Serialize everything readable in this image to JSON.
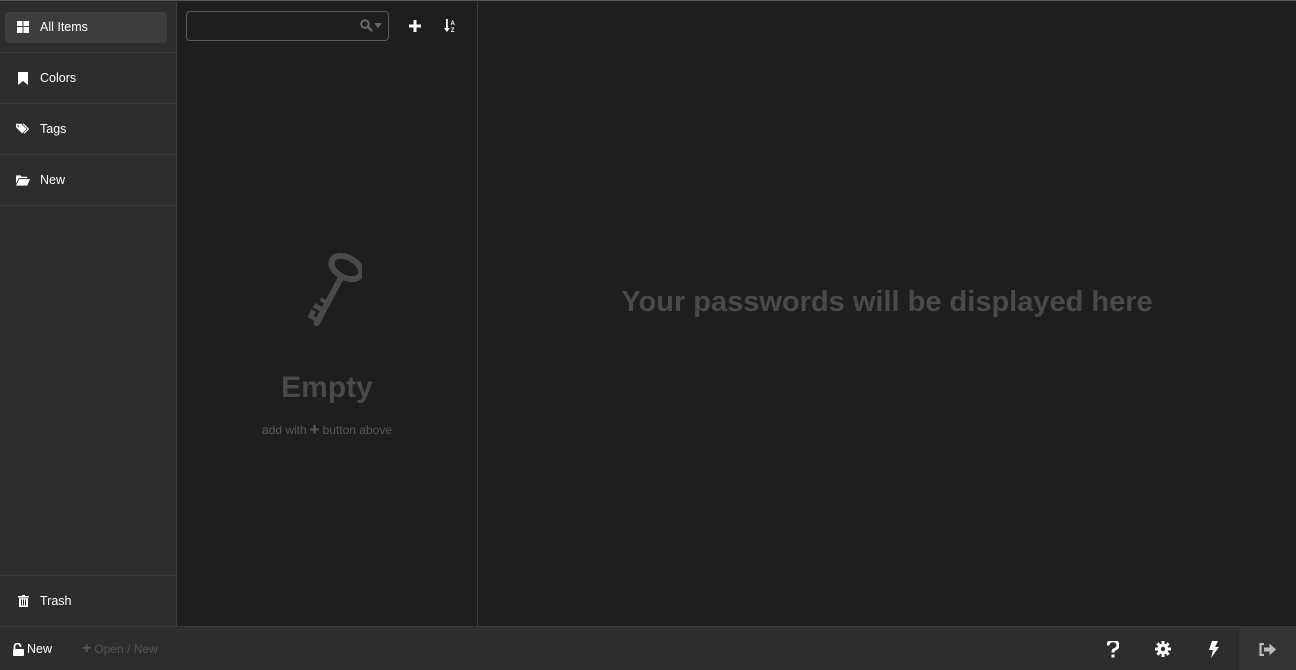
{
  "sidebar": {
    "items": [
      {
        "label": "All Items",
        "icon": "grid-icon",
        "active": true
      },
      {
        "label": "Colors",
        "icon": "bookmark-icon"
      },
      {
        "label": "Tags",
        "icon": "tags-icon"
      },
      {
        "label": "New",
        "icon": "folder-open-icon"
      }
    ],
    "trash": {
      "label": "Trash",
      "icon": "trash-icon"
    }
  },
  "list": {
    "search": {
      "value": "",
      "placeholder": ""
    },
    "add_button_icon": "plus-icon",
    "sort_button_icon": "sort-alpha-icon",
    "empty": {
      "icon": "key-icon",
      "title": "Empty",
      "hint_before": "add with",
      "hint_after": "button above"
    }
  },
  "details": {
    "placeholder": "Your passwords will be displayed here"
  },
  "footer": {
    "file_label": "New",
    "file_icon": "unlock-icon",
    "open_label": "Open / New",
    "buttons": [
      "help-icon",
      "settings-icon",
      "generator-icon",
      "lock-icon"
    ]
  },
  "colors": {
    "sidebar_bg": "#2d2d2d",
    "panel_bg": "#1e1e1e",
    "active_item_bg": "#3d3d3d",
    "muted_text": "#4a4a4a"
  }
}
